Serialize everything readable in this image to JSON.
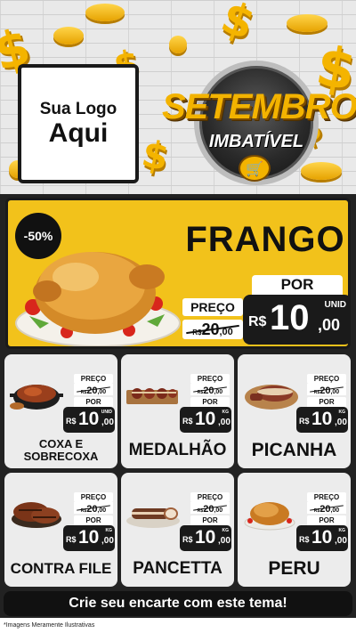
{
  "logo": {
    "line1": "Sua Logo",
    "line2": "Aqui"
  },
  "campaign": {
    "title": "SETEMBRO",
    "subtitle": "IMBATÍVEL",
    "cart_icon": "cart-icon"
  },
  "colors": {
    "accent": "#f2c21b",
    "dark": "#1a1a1a",
    "card": "#ececec",
    "coin": "#f4b400"
  },
  "featured": {
    "discount": "-50%",
    "name": "FRANGO",
    "preco_label": "PREÇO",
    "por_label": "POR",
    "old_currency": "R$",
    "old_int": "20",
    "old_dec": ",00",
    "currency": "R$",
    "price_int": "10",
    "price_dec": ",00",
    "unit": "UNID"
  },
  "products": [
    {
      "name": "COXA E SOBRECOXA",
      "preco_label": "PREÇO",
      "old_currency": "R$",
      "old_int": "20",
      "old_dec": ",00",
      "por_label": "POR",
      "currency": "R$",
      "price_int": "10",
      "price_dec": ",00",
      "unit": "UNID"
    },
    {
      "name": "MEDALHÃO",
      "preco_label": "PREÇO",
      "old_currency": "R$",
      "old_int": "20",
      "old_dec": ",00",
      "por_label": "POR",
      "currency": "R$",
      "price_int": "10",
      "price_dec": ",00",
      "unit": "KG"
    },
    {
      "name": "PICANHA",
      "preco_label": "PREÇO",
      "old_currency": "R$",
      "old_int": "20",
      "old_dec": ",00",
      "por_label": "POR",
      "currency": "R$",
      "price_int": "10",
      "price_dec": ",00",
      "unit": "KG"
    },
    {
      "name": "CONTRA FILE",
      "preco_label": "PREÇO",
      "old_currency": "R$",
      "old_int": "20",
      "old_dec": ",00",
      "por_label": "POR",
      "currency": "R$",
      "price_int": "10",
      "price_dec": ",00",
      "unit": "KG"
    },
    {
      "name": "PANCETTA",
      "preco_label": "PREÇO",
      "old_currency": "R$",
      "old_int": "20",
      "old_dec": ",00",
      "por_label": "POR",
      "currency": "R$",
      "price_int": "10",
      "price_dec": ",00",
      "unit": "KG"
    },
    {
      "name": "PERU",
      "preco_label": "PREÇO",
      "old_currency": "R$",
      "old_int": "20",
      "old_dec": ",00",
      "por_label": "POR",
      "currency": "R$",
      "price_int": "10",
      "price_dec": ",00",
      "unit": "KG"
    }
  ],
  "cta": "Crie seu encarte com este tema!",
  "disclaimer": "*Imagens Meramente Ilustrativas"
}
